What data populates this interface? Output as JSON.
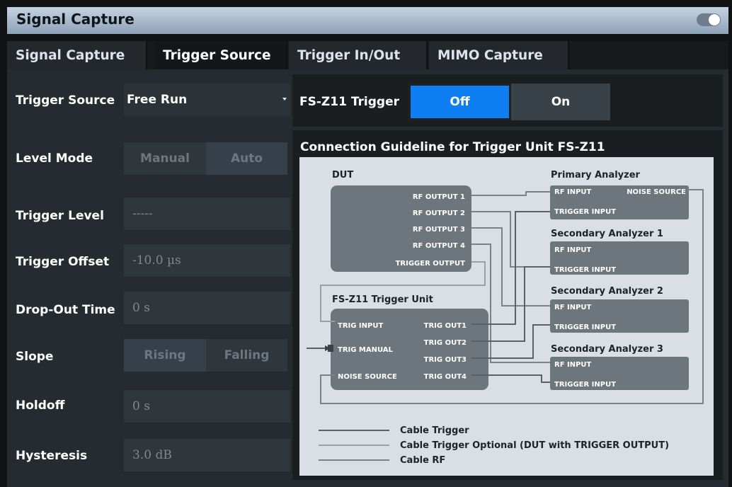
{
  "window": {
    "title": "Signal Capture"
  },
  "tabs": [
    {
      "label": "Signal Capture"
    },
    {
      "label": "Trigger Source"
    },
    {
      "label": "Trigger In/Out"
    },
    {
      "label": "MIMO Capture"
    }
  ],
  "settings": {
    "trigger_source": {
      "label": "Trigger Source",
      "value": "Free Run"
    },
    "level_mode": {
      "label": "Level Mode",
      "options": [
        "Manual",
        "Auto"
      ],
      "selected": "Auto"
    },
    "trigger_level": {
      "label": "Trigger Level",
      "value": "-----"
    },
    "trigger_offset": {
      "label": "Trigger Offset",
      "value": "-10.0 µs"
    },
    "dropout_time": {
      "label": "Drop-Out Time",
      "value": "0 s"
    },
    "slope": {
      "label": "Slope",
      "options": [
        "Rising",
        "Falling"
      ],
      "selected": "Rising"
    },
    "holdoff": {
      "label": "Holdoff",
      "value": "0 s"
    },
    "hysteresis": {
      "label": "Hysteresis",
      "value": "3.0 dB"
    }
  },
  "fsz11": {
    "label": "FS-Z11 Trigger",
    "off": "Off",
    "on": "On",
    "selected": "Off"
  },
  "guideline": {
    "title": "Connection Guideline for Trigger Unit FS-Z11",
    "dut": {
      "title": "DUT",
      "ports": [
        "RF OUTPUT 1",
        "RF OUTPUT 2",
        "RF OUTPUT 3",
        "RF OUTPUT 4",
        "TRIGGER OUTPUT"
      ]
    },
    "trigger_unit": {
      "title": "FS-Z11 Trigger Unit",
      "left_ports": [
        "TRIG INPUT",
        "TRIG MANUAL",
        "NOISE SOURCE"
      ],
      "right_ports": [
        "TRIG OUT1",
        "TRIG OUT2",
        "TRIG OUT3",
        "TRIG OUT4"
      ]
    },
    "analyzers": [
      {
        "title": "Primary Analyzer",
        "rf": "RF INPUT",
        "noise": "NOISE SOURCE",
        "trigger": "TRIGGER INPUT"
      },
      {
        "title": "Secondary Analyzer 1",
        "rf": "RF INPUT",
        "trigger": "TRIGGER INPUT"
      },
      {
        "title": "Secondary Analyzer 2",
        "rf": "RF INPUT",
        "trigger": "TRIGGER INPUT"
      },
      {
        "title": "Secondary Analyzer 3",
        "rf": "RF INPUT",
        "trigger": "TRIGGER INPUT"
      }
    ],
    "legend": [
      "Cable Trigger",
      "Cable Trigger Optional (DUT with TRIGGER OUTPUT)",
      "Cable RF"
    ]
  },
  "colors": {
    "accent": "#0e7ef2",
    "cable_trigger": "#5a6168",
    "cable_optional": "#9aa0a6",
    "cable_rf": "#7d8288",
    "box_fill": "#6d757d"
  }
}
